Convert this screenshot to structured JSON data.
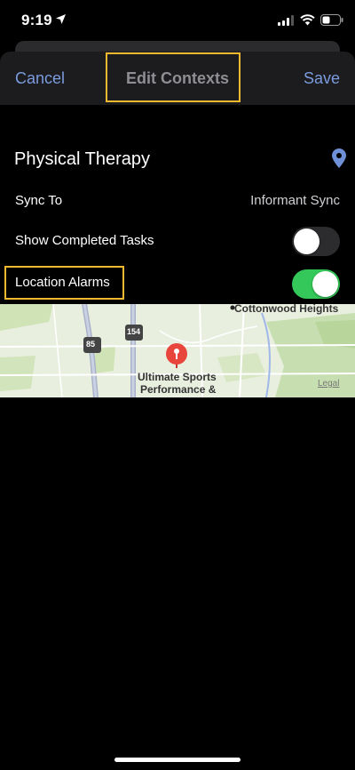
{
  "status_bar": {
    "time": "9:19",
    "icons": [
      "location-arrow-icon",
      "cellular-signal-icon",
      "wifi-icon",
      "battery-icon"
    ]
  },
  "nav": {
    "cancel_label": "Cancel",
    "title": "Edit Contexts",
    "save_label": "Save"
  },
  "context": {
    "name": "Physical Therapy"
  },
  "settings": {
    "sync_label": "Sync To",
    "sync_value": "Informant Sync",
    "completed_label": "Show Completed Tasks",
    "completed_on": false,
    "alarms_label": "Location Alarms",
    "alarms_on": true
  },
  "map": {
    "place_label_line1": "Ultimate Sports",
    "place_label_line2": "Performance &",
    "area_label": "Cottonwood Heights",
    "route_85": "85",
    "route_154": "154",
    "legal": "Legal"
  },
  "colors": {
    "accent_blue": "#7b9bde",
    "toggle_on": "#34c759",
    "highlight": "#f2b830",
    "pin_red": "#e8453c"
  }
}
